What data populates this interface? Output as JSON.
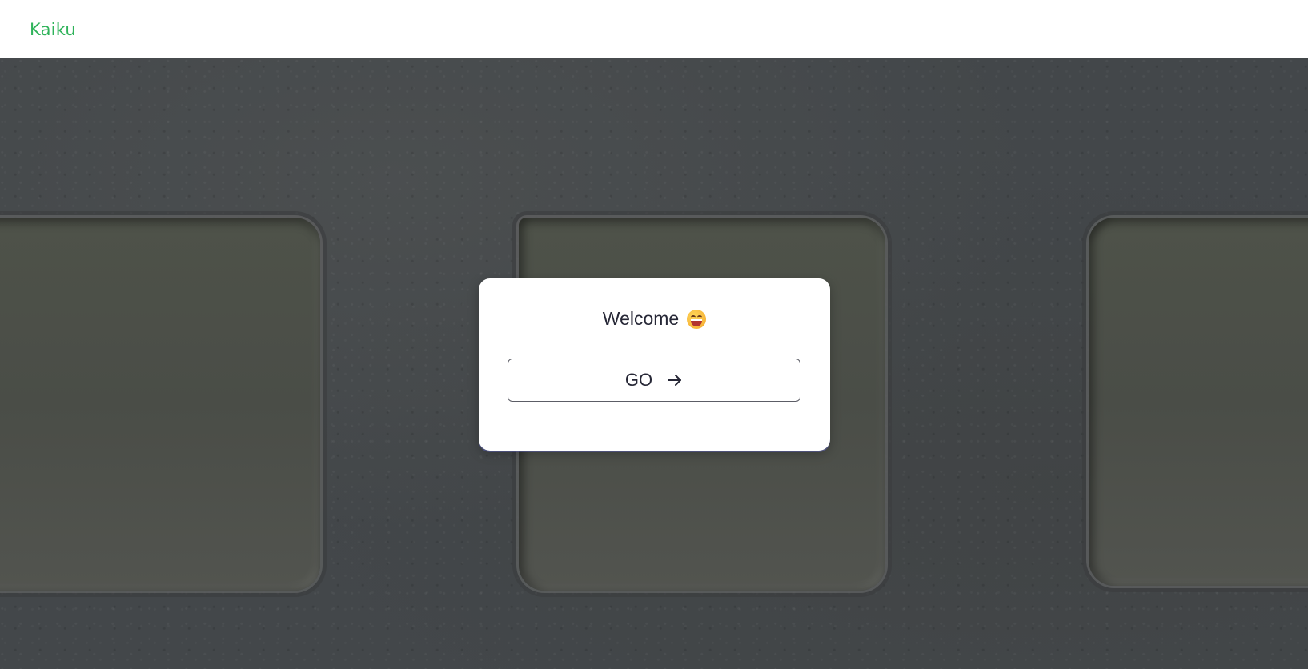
{
  "header": {
    "brand": "Kaiku"
  },
  "card": {
    "welcome_text": "Welcome",
    "welcome_icon": "grinning-face-emoji",
    "go_button_label": "GO",
    "go_button_icon": "arrow-right-icon"
  },
  "colors": {
    "brand": "#2fb35a",
    "text": "#262736",
    "card_bg": "#ffffff",
    "hero_bg": "#43474a"
  }
}
